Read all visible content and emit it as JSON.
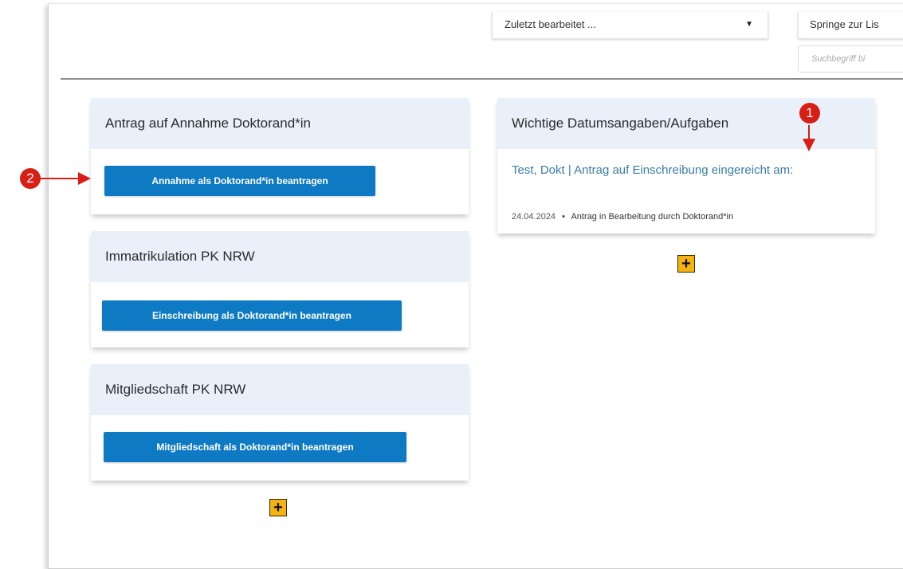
{
  "toolbar": {
    "recent_select_value": "Zuletzt bearbeitet ...",
    "jump_field_value": "Springe zur Lis",
    "search_placeholder": "Suchbegriff bi"
  },
  "left_cards": [
    {
      "title": "Antrag auf Annahme Doktorand*in",
      "button_label": "Annahme als Doktorand*in beantragen"
    },
    {
      "title": "Immatrikulation PK NRW",
      "button_label": "Einschreibung als Doktorand*in beantragen"
    },
    {
      "title": "Mitgliedschaft PK NRW",
      "button_label": "Mitgliedschaft als Doktorand*in beantragen"
    }
  ],
  "right_card": {
    "title": "Wichtige Datumsangaben/Aufgaben",
    "task": {
      "link_text": "Test, Dokt | Antrag auf Einschreibung eingereicht am:",
      "date": "24.04.2024",
      "separator": "•",
      "status": "Antrag in Bearbeitung durch Doktorand*in"
    }
  },
  "add_button_symbol": "+",
  "annotations": {
    "marker_1": "1",
    "marker_2": "2",
    "marker_color": "#d81f15"
  },
  "colors": {
    "primary_button": "#0f7ac4",
    "card_header_bg": "#e9f0fa",
    "add_button": "#f3b312",
    "link": "#3a7ca8"
  }
}
